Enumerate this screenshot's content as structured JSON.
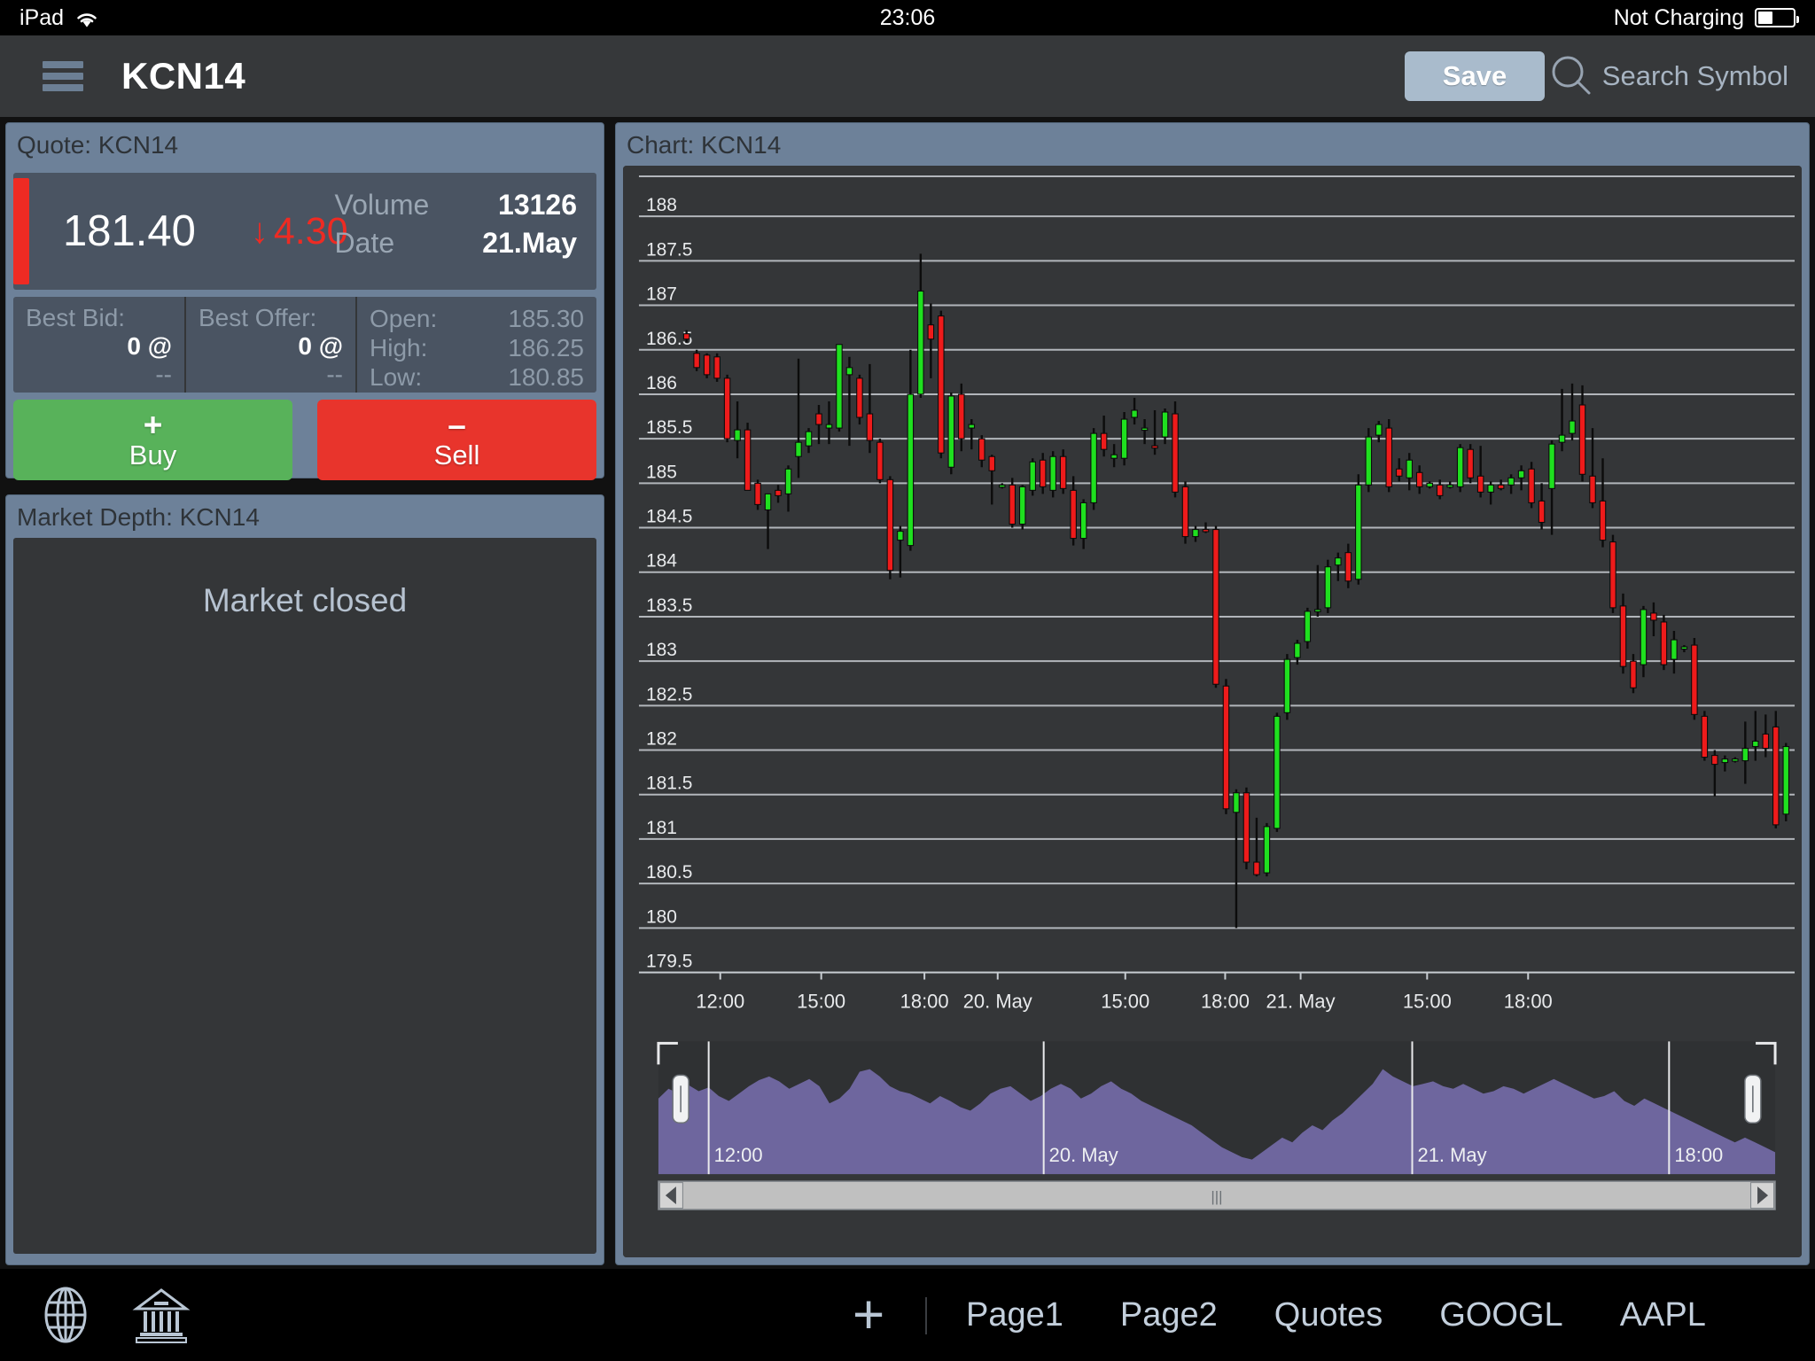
{
  "status_bar": {
    "device": "iPad",
    "wifi_icon": "wifi-icon",
    "time": "23:06",
    "power_state": "Not Charging",
    "battery_icon": "battery-icon",
    "battery_level_pct": 40
  },
  "navbar": {
    "menu_icon": "hamburger-menu-icon",
    "title": "KCN14",
    "save_label": "Save",
    "search_icon": "search-icon",
    "search_placeholder": "Search Symbol"
  },
  "quote": {
    "header": "Quote: KCN14",
    "last_price": "181.40",
    "change": "4.30",
    "change_direction": "down",
    "change_arrow": "↓",
    "trend_color": "#ee2b23",
    "volume_label": "Volume",
    "volume_value": "13126",
    "date_label": "Date",
    "date_value": "21.May",
    "best_bid_label": "Best Bid:",
    "best_bid_qty": "0 @",
    "best_bid_price": "--",
    "best_offer_label": "Best Offer:",
    "best_offer_qty": "0 @",
    "best_offer_price": "--",
    "open_label": "Open:",
    "open_value": "185.30",
    "high_label": "High:",
    "high_value": "186.25",
    "low_label": "Low:",
    "low_value": "180.85",
    "buy_sign": "+",
    "buy_label": "Buy",
    "buy_color": "#58b25a",
    "sell_sign": "–",
    "sell_label": "Sell",
    "sell_color": "#e8342c"
  },
  "market_depth": {
    "header": "Market Depth: KCN14",
    "empty_message": "Market closed"
  },
  "chart_panel": {
    "header": "Chart: KCN14"
  },
  "tabbar": {
    "globe_icon": "globe-icon",
    "bank_icon": "bank-icon",
    "add_icon": "plus-icon",
    "links": [
      {
        "label": "Page1"
      },
      {
        "label": "Page2"
      },
      {
        "label": "Quotes"
      },
      {
        "label": "GOOGL"
      },
      {
        "label": "AAPL"
      }
    ]
  },
  "chart_data": {
    "type": "candlestick",
    "title": "Chart: KCN14",
    "symbol": "KCN14",
    "xlabel": "",
    "ylabel": "",
    "ylim": [
      179.5,
      188.45
    ],
    "grid": true,
    "y_ticks": [
      188,
      187.5,
      187,
      186.5,
      186,
      185.5,
      185,
      184.5,
      184,
      183.5,
      183,
      182.5,
      182,
      181.5,
      181,
      180.5,
      180,
      179.5
    ],
    "x_tick_labels": [
      "12:00",
      "15:00",
      "18:00",
      "20. May",
      "15:00",
      "18:00",
      "21. May",
      "15:00",
      "18:00"
    ],
    "x_tick_positions": [
      0.035,
      0.126,
      0.219,
      0.285,
      0.4,
      0.49,
      0.558,
      0.672,
      0.763
    ],
    "up_color": "#1fe01f",
    "down_color": "#ee1b1b",
    "wick_color": "#0c0c0c",
    "plot_bg": "#343638",
    "gridline_color": "#c8cdd2",
    "axis_label_color": "#e8eaec",
    "navigator": {
      "series_color": "#6e669e",
      "track_color": "#b8b8b8",
      "labels": [
        "12:00",
        "20. May",
        "21. May",
        "18:00"
      ],
      "label_positions": [
        0.045,
        0.345,
        0.675,
        0.905
      ],
      "handle_left_pct": 2.0,
      "handle_right_pct": 98.0,
      "area_values": [
        0.62,
        0.7,
        0.66,
        0.73,
        0.68,
        0.71,
        0.64,
        0.6,
        0.66,
        0.72,
        0.77,
        0.8,
        0.76,
        0.7,
        0.74,
        0.78,
        0.72,
        0.58,
        0.62,
        0.7,
        0.84,
        0.86,
        0.8,
        0.72,
        0.68,
        0.66,
        0.62,
        0.58,
        0.64,
        0.6,
        0.55,
        0.52,
        0.58,
        0.66,
        0.7,
        0.72,
        0.66,
        0.6,
        0.64,
        0.7,
        0.74,
        0.7,
        0.62,
        0.66,
        0.72,
        0.76,
        0.7,
        0.66,
        0.6,
        0.56,
        0.52,
        0.48,
        0.44,
        0.4,
        0.34,
        0.28,
        0.22,
        0.18,
        0.14,
        0.12,
        0.18,
        0.24,
        0.3,
        0.26,
        0.34,
        0.4,
        0.36,
        0.44,
        0.5,
        0.58,
        0.66,
        0.74,
        0.86,
        0.8,
        0.76,
        0.72,
        0.74,
        0.76,
        0.72,
        0.7,
        0.74,
        0.7,
        0.66,
        0.68,
        0.72,
        0.7,
        0.66,
        0.7,
        0.74,
        0.78,
        0.74,
        0.7,
        0.66,
        0.62,
        0.64,
        0.68,
        0.6,
        0.56,
        0.62,
        0.58,
        0.54,
        0.5,
        0.46,
        0.42,
        0.38,
        0.34,
        0.3,
        0.26,
        0.3,
        0.26,
        0.22,
        0.18
      ],
      "scroll_grip": "|||"
    },
    "candles": [
      {
        "t": 0,
        "o": 186.68,
        "h": 186.72,
        "l": 186.58,
        "c": 186.62,
        "d": "down"
      },
      {
        "t": 1,
        "o": 186.46,
        "h": 186.5,
        "l": 186.26,
        "c": 186.3,
        "d": "down"
      },
      {
        "t": 2,
        "o": 186.44,
        "h": 186.46,
        "l": 186.18,
        "c": 186.22,
        "d": "down"
      },
      {
        "t": 3,
        "o": 186.42,
        "h": 186.46,
        "l": 186.14,
        "c": 186.18,
        "d": "down"
      },
      {
        "t": 4,
        "o": 186.18,
        "h": 186.22,
        "l": 185.46,
        "c": 185.5,
        "d": "down"
      },
      {
        "t": 5,
        "o": 185.48,
        "h": 185.92,
        "l": 185.28,
        "c": 185.6,
        "d": "up"
      },
      {
        "t": 6,
        "o": 185.6,
        "h": 185.68,
        "l": 185.22,
        "c": 184.92,
        "d": "down"
      },
      {
        "t": 7,
        "o": 185.0,
        "h": 185.04,
        "l": 184.7,
        "c": 184.76,
        "d": "down"
      },
      {
        "t": 8,
        "o": 184.7,
        "h": 184.8,
        "l": 184.26,
        "c": 184.88,
        "d": "up"
      },
      {
        "t": 9,
        "o": 184.92,
        "h": 184.98,
        "l": 184.78,
        "c": 184.86,
        "d": "down"
      },
      {
        "t": 10,
        "o": 184.88,
        "h": 185.2,
        "l": 184.68,
        "c": 185.16,
        "d": "up"
      },
      {
        "t": 11,
        "o": 185.3,
        "h": 186.4,
        "l": 185.06,
        "c": 185.46,
        "d": "up"
      },
      {
        "t": 12,
        "o": 185.42,
        "h": 185.62,
        "l": 185.34,
        "c": 185.58,
        "d": "up"
      },
      {
        "t": 13,
        "o": 185.78,
        "h": 185.88,
        "l": 185.44,
        "c": 185.66,
        "d": "down"
      },
      {
        "t": 14,
        "o": 185.62,
        "h": 185.92,
        "l": 185.44,
        "c": 185.66,
        "d": "up"
      },
      {
        "t": 15,
        "o": 185.62,
        "h": 186.56,
        "l": 185.58,
        "c": 186.56,
        "d": "up"
      },
      {
        "t": 16,
        "o": 186.22,
        "h": 186.42,
        "l": 185.42,
        "c": 186.3,
        "d": "up"
      },
      {
        "t": 17,
        "o": 186.18,
        "h": 186.22,
        "l": 185.66,
        "c": 185.74,
        "d": "down"
      },
      {
        "t": 18,
        "o": 185.78,
        "h": 186.34,
        "l": 185.34,
        "c": 185.48,
        "d": "down"
      },
      {
        "t": 19,
        "o": 185.46,
        "h": 185.5,
        "l": 185.0,
        "c": 185.04,
        "d": "down"
      },
      {
        "t": 20,
        "o": 185.04,
        "h": 185.08,
        "l": 183.92,
        "c": 184.02,
        "d": "down"
      },
      {
        "t": 21,
        "o": 184.46,
        "h": 184.52,
        "l": 183.94,
        "c": 184.36,
        "d": "up"
      },
      {
        "t": 22,
        "o": 184.3,
        "h": 186.5,
        "l": 184.24,
        "c": 186.0,
        "d": "up"
      },
      {
        "t": 23,
        "o": 186.0,
        "h": 187.58,
        "l": 185.96,
        "c": 187.16,
        "d": "up"
      },
      {
        "t": 24,
        "o": 186.78,
        "h": 187.02,
        "l": 186.18,
        "c": 186.62,
        "d": "down"
      },
      {
        "t": 25,
        "o": 186.88,
        "h": 186.94,
        "l": 185.28,
        "c": 185.34,
        "d": "down"
      },
      {
        "t": 26,
        "o": 185.98,
        "h": 186.02,
        "l": 185.1,
        "c": 185.18,
        "d": "up"
      },
      {
        "t": 27,
        "o": 186.0,
        "h": 186.12,
        "l": 185.36,
        "c": 185.5,
        "d": "down"
      },
      {
        "t": 28,
        "o": 185.62,
        "h": 185.72,
        "l": 185.38,
        "c": 185.66,
        "d": "up"
      },
      {
        "t": 29,
        "o": 185.5,
        "h": 185.54,
        "l": 185.18,
        "c": 185.26,
        "d": "down"
      },
      {
        "t": 30,
        "o": 185.3,
        "h": 185.32,
        "l": 184.76,
        "c": 185.14,
        "d": "down"
      },
      {
        "t": 31,
        "o": 184.98,
        "h": 185.0,
        "l": 184.94,
        "c": 184.98,
        "d": "up"
      },
      {
        "t": 32,
        "o": 184.98,
        "h": 185.06,
        "l": 184.5,
        "c": 184.54,
        "d": "down"
      },
      {
        "t": 33,
        "o": 184.54,
        "h": 184.98,
        "l": 184.48,
        "c": 184.96,
        "d": "up"
      },
      {
        "t": 34,
        "o": 184.92,
        "h": 185.28,
        "l": 184.86,
        "c": 185.24,
        "d": "up"
      },
      {
        "t": 35,
        "o": 185.26,
        "h": 185.34,
        "l": 184.88,
        "c": 184.96,
        "d": "down"
      },
      {
        "t": 36,
        "o": 184.92,
        "h": 185.36,
        "l": 184.84,
        "c": 185.3,
        "d": "up"
      },
      {
        "t": 37,
        "o": 185.3,
        "h": 185.38,
        "l": 184.88,
        "c": 184.94,
        "d": "down"
      },
      {
        "t": 38,
        "o": 184.92,
        "h": 185.08,
        "l": 184.3,
        "c": 184.38,
        "d": "down"
      },
      {
        "t": 39,
        "o": 184.38,
        "h": 184.82,
        "l": 184.26,
        "c": 184.78,
        "d": "up"
      },
      {
        "t": 40,
        "o": 184.78,
        "h": 185.62,
        "l": 184.7,
        "c": 185.56,
        "d": "up"
      },
      {
        "t": 41,
        "o": 185.56,
        "h": 185.76,
        "l": 185.3,
        "c": 185.38,
        "d": "down"
      },
      {
        "t": 42,
        "o": 185.32,
        "h": 185.44,
        "l": 185.18,
        "c": 185.28,
        "d": "up"
      },
      {
        "t": 43,
        "o": 185.28,
        "h": 185.8,
        "l": 185.2,
        "c": 185.72,
        "d": "up"
      },
      {
        "t": 44,
        "o": 185.74,
        "h": 185.96,
        "l": 185.66,
        "c": 185.82,
        "d": "up"
      },
      {
        "t": 45,
        "o": 185.62,
        "h": 185.72,
        "l": 185.44,
        "c": 185.62,
        "d": "up"
      },
      {
        "t": 46,
        "o": 185.42,
        "h": 185.82,
        "l": 185.32,
        "c": 185.4,
        "d": "down"
      },
      {
        "t": 47,
        "o": 185.52,
        "h": 185.84,
        "l": 185.44,
        "c": 185.8,
        "d": "up"
      },
      {
        "t": 48,
        "o": 185.78,
        "h": 185.92,
        "l": 184.84,
        "c": 184.9,
        "d": "down"
      },
      {
        "t": 49,
        "o": 184.96,
        "h": 185.02,
        "l": 184.32,
        "c": 184.4,
        "d": "down"
      },
      {
        "t": 50,
        "o": 184.4,
        "h": 184.52,
        "l": 184.34,
        "c": 184.48,
        "d": "up"
      },
      {
        "t": 51,
        "o": 184.48,
        "h": 184.56,
        "l": 184.44,
        "c": 184.46,
        "d": "down"
      },
      {
        "t": 52,
        "o": 184.48,
        "h": 184.52,
        "l": 182.7,
        "c": 182.74,
        "d": "down"
      },
      {
        "t": 53,
        "o": 182.72,
        "h": 182.8,
        "l": 181.28,
        "c": 181.34,
        "d": "down"
      },
      {
        "t": 54,
        "o": 181.3,
        "h": 181.56,
        "l": 180.0,
        "c": 181.52,
        "d": "up"
      },
      {
        "t": 55,
        "o": 181.52,
        "h": 181.58,
        "l": 180.66,
        "c": 180.74,
        "d": "down"
      },
      {
        "t": 56,
        "o": 180.74,
        "h": 181.24,
        "l": 180.58,
        "c": 180.6,
        "d": "down"
      },
      {
        "t": 57,
        "o": 180.62,
        "h": 181.18,
        "l": 180.58,
        "c": 181.14,
        "d": "up"
      },
      {
        "t": 58,
        "o": 181.12,
        "h": 182.42,
        "l": 181.08,
        "c": 182.38,
        "d": "up"
      },
      {
        "t": 59,
        "o": 182.42,
        "h": 183.08,
        "l": 182.34,
        "c": 183.02,
        "d": "up"
      },
      {
        "t": 60,
        "o": 183.04,
        "h": 183.24,
        "l": 182.96,
        "c": 183.2,
        "d": "up"
      },
      {
        "t": 61,
        "o": 183.22,
        "h": 183.6,
        "l": 183.14,
        "c": 183.56,
        "d": "up"
      },
      {
        "t": 62,
        "o": 183.56,
        "h": 184.08,
        "l": 183.5,
        "c": 183.58,
        "d": "up"
      },
      {
        "t": 63,
        "o": 183.6,
        "h": 184.14,
        "l": 183.54,
        "c": 184.06,
        "d": "up"
      },
      {
        "t": 64,
        "o": 184.08,
        "h": 184.22,
        "l": 183.9,
        "c": 184.16,
        "d": "up"
      },
      {
        "t": 65,
        "o": 184.22,
        "h": 184.32,
        "l": 183.82,
        "c": 183.9,
        "d": "down"
      },
      {
        "t": 66,
        "o": 183.92,
        "h": 185.1,
        "l": 183.86,
        "c": 184.98,
        "d": "up"
      },
      {
        "t": 67,
        "o": 184.98,
        "h": 185.62,
        "l": 184.9,
        "c": 185.52,
        "d": "up"
      },
      {
        "t": 68,
        "o": 185.54,
        "h": 185.7,
        "l": 185.46,
        "c": 185.66,
        "d": "up"
      },
      {
        "t": 69,
        "o": 185.62,
        "h": 185.72,
        "l": 184.9,
        "c": 184.96,
        "d": "down"
      },
      {
        "t": 70,
        "o": 185.16,
        "h": 185.28,
        "l": 185.02,
        "c": 185.08,
        "d": "down"
      },
      {
        "t": 71,
        "o": 185.06,
        "h": 185.34,
        "l": 184.92,
        "c": 185.26,
        "d": "up"
      },
      {
        "t": 72,
        "o": 185.12,
        "h": 185.2,
        "l": 184.88,
        "c": 184.96,
        "d": "down"
      },
      {
        "t": 73,
        "o": 184.96,
        "h": 185.02,
        "l": 184.94,
        "c": 185.0,
        "d": "up"
      },
      {
        "t": 74,
        "o": 184.98,
        "h": 185.04,
        "l": 184.82,
        "c": 184.86,
        "d": "down"
      },
      {
        "t": 75,
        "o": 184.98,
        "h": 185.02,
        "l": 184.94,
        "c": 184.96,
        "d": "up"
      },
      {
        "t": 76,
        "o": 184.96,
        "h": 185.44,
        "l": 184.9,
        "c": 185.4,
        "d": "up"
      },
      {
        "t": 77,
        "o": 185.38,
        "h": 185.44,
        "l": 185.0,
        "c": 185.06,
        "d": "down"
      },
      {
        "t": 78,
        "o": 185.08,
        "h": 185.42,
        "l": 184.84,
        "c": 184.9,
        "d": "down"
      },
      {
        "t": 79,
        "o": 184.9,
        "h": 185.02,
        "l": 184.76,
        "c": 184.98,
        "d": "up"
      },
      {
        "t": 80,
        "o": 184.98,
        "h": 185.04,
        "l": 184.92,
        "c": 184.94,
        "d": "down"
      },
      {
        "t": 81,
        "o": 184.98,
        "h": 185.1,
        "l": 184.88,
        "c": 185.06,
        "d": "up"
      },
      {
        "t": 82,
        "o": 185.06,
        "h": 185.2,
        "l": 184.92,
        "c": 185.14,
        "d": "up"
      },
      {
        "t": 83,
        "o": 185.16,
        "h": 185.24,
        "l": 184.72,
        "c": 184.78,
        "d": "down"
      },
      {
        "t": 84,
        "o": 184.8,
        "h": 185.0,
        "l": 184.48,
        "c": 184.56,
        "d": "down"
      },
      {
        "t": 85,
        "o": 184.94,
        "h": 185.48,
        "l": 184.42,
        "c": 185.44,
        "d": "up"
      },
      {
        "t": 86,
        "o": 185.46,
        "h": 186.06,
        "l": 185.36,
        "c": 185.54,
        "d": "up"
      },
      {
        "t": 87,
        "o": 185.56,
        "h": 186.12,
        "l": 185.48,
        "c": 185.7,
        "d": "up"
      },
      {
        "t": 88,
        "o": 185.88,
        "h": 186.1,
        "l": 185.02,
        "c": 185.1,
        "d": "down"
      },
      {
        "t": 89,
        "o": 185.08,
        "h": 185.62,
        "l": 184.72,
        "c": 184.78,
        "d": "down"
      },
      {
        "t": 90,
        "o": 184.8,
        "h": 185.28,
        "l": 184.28,
        "c": 184.36,
        "d": "down"
      },
      {
        "t": 91,
        "o": 184.34,
        "h": 184.42,
        "l": 183.54,
        "c": 183.6,
        "d": "down"
      },
      {
        "t": 92,
        "o": 183.62,
        "h": 183.76,
        "l": 182.86,
        "c": 182.94,
        "d": "down"
      },
      {
        "t": 93,
        "o": 183.0,
        "h": 183.08,
        "l": 182.64,
        "c": 182.7,
        "d": "down"
      },
      {
        "t": 94,
        "o": 182.96,
        "h": 183.62,
        "l": 182.82,
        "c": 183.58,
        "d": "up"
      },
      {
        "t": 95,
        "o": 183.46,
        "h": 183.66,
        "l": 183.28,
        "c": 183.54,
        "d": "down"
      },
      {
        "t": 96,
        "o": 183.44,
        "h": 183.52,
        "l": 182.9,
        "c": 182.96,
        "d": "down"
      },
      {
        "t": 97,
        "o": 183.02,
        "h": 183.34,
        "l": 182.86,
        "c": 183.24,
        "d": "up"
      },
      {
        "t": 98,
        "o": 183.14,
        "h": 183.18,
        "l": 183.1,
        "c": 183.16,
        "d": "up"
      },
      {
        "t": 99,
        "o": 183.18,
        "h": 183.26,
        "l": 182.34,
        "c": 182.4,
        "d": "down"
      },
      {
        "t": 100,
        "o": 182.38,
        "h": 182.44,
        "l": 181.88,
        "c": 181.92,
        "d": "down"
      },
      {
        "t": 101,
        "o": 181.94,
        "h": 182.0,
        "l": 181.48,
        "c": 181.84,
        "d": "down"
      },
      {
        "t": 102,
        "o": 181.86,
        "h": 181.94,
        "l": 181.76,
        "c": 181.9,
        "d": "up"
      },
      {
        "t": 103,
        "o": 181.88,
        "h": 181.92,
        "l": 181.86,
        "c": 181.9,
        "d": "up"
      },
      {
        "t": 104,
        "o": 181.88,
        "h": 182.32,
        "l": 181.62,
        "c": 182.02,
        "d": "up"
      },
      {
        "t": 105,
        "o": 182.04,
        "h": 182.44,
        "l": 181.88,
        "c": 182.1,
        "d": "up"
      },
      {
        "t": 106,
        "o": 182.18,
        "h": 182.4,
        "l": 181.92,
        "c": 182.02,
        "d": "down"
      },
      {
        "t": 107,
        "o": 182.26,
        "h": 182.44,
        "l": 181.12,
        "c": 181.16,
        "d": "down"
      },
      {
        "t": 108,
        "o": 182.04,
        "h": 182.08,
        "l": 181.2,
        "c": 181.28,
        "d": "up"
      }
    ]
  }
}
